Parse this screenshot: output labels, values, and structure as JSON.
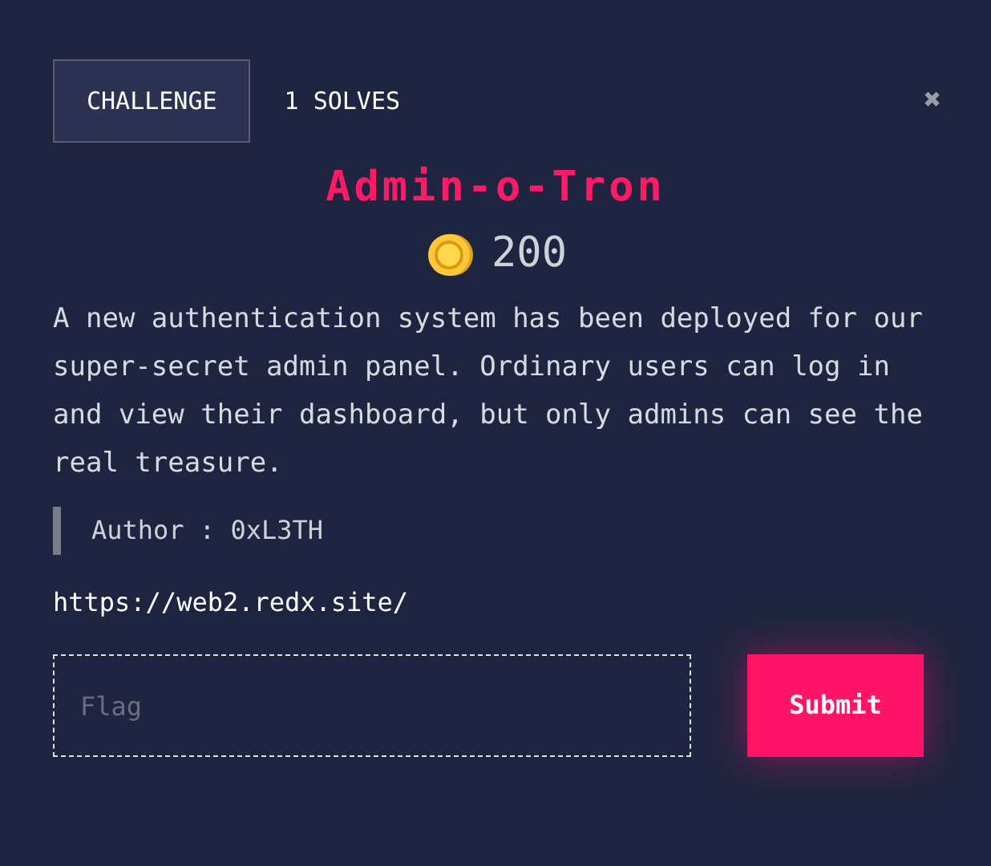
{
  "tabs": [
    {
      "label": "CHALLENGE",
      "selected": true
    },
    {
      "label": "1 SOLVES",
      "selected": false
    }
  ],
  "close": "✖",
  "title": "Admin-o-Tron",
  "points": "200",
  "description": "A new authentication system has been deployed for our super-secret admin panel. Ordinary users can log in and view their dashboard, but only admins can see the real treasure.",
  "author": "Author : 0xL3TH",
  "link": "https://web2.redx.site/",
  "flag_field": {
    "placeholder": "Flag"
  },
  "submit": "Submit"
}
